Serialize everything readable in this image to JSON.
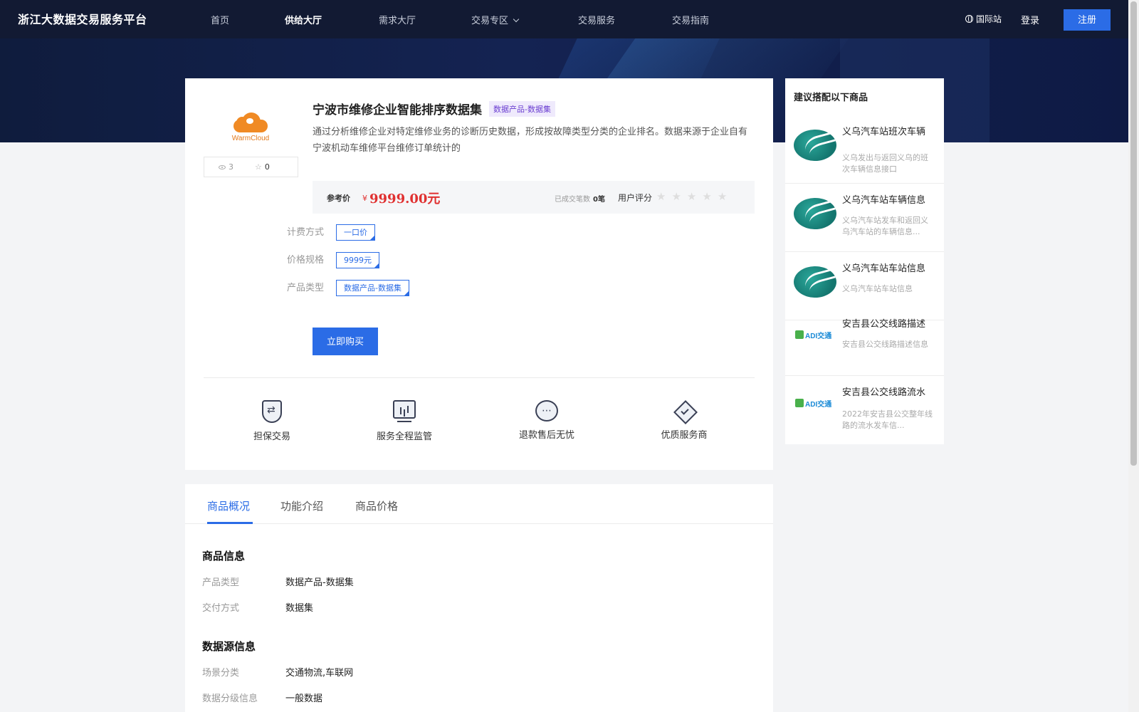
{
  "nav": {
    "logo": "浙江大数据交易服务平台",
    "items": [
      "首页",
      "供给大厅",
      "需求大厅",
      "交易专区",
      "交易服务",
      "交易指南"
    ],
    "intl": "国际站",
    "login": "登录",
    "register": "注册"
  },
  "product": {
    "brand": "WarmCloud",
    "views": "3",
    "favorites": "0",
    "title": "宁波市维修企业智能排序数据集",
    "tag": "数据产品-数据集",
    "description": "通过分析维修企业对特定维修业务的诊断历史数据，形成按故障类型分类的企业排名。数据来源于企业自有宁波机动车维修平台维修订单统计的",
    "price_label": "参考价",
    "price_symbol": "¥",
    "price": "9999.00元",
    "deals_label": "已成交笔数",
    "deals_value": "0笔",
    "rating_label": "用户评分",
    "stars": [
      "★",
      "★",
      "★",
      "★",
      "★"
    ],
    "specs": [
      {
        "label": "计费方式",
        "option": "一口价"
      },
      {
        "label": "价格规格",
        "option": "9999元"
      },
      {
        "label": "产品类型",
        "option": "数据产品-数据集"
      }
    ],
    "buy_label": "立即购买",
    "features": [
      "担保交易",
      "服务全程监管",
      "退款售后无忧",
      "优质服务商"
    ]
  },
  "recommend": {
    "title": "建议搭配以下商品",
    "items": [
      {
        "name": "义乌汽车站班次车辆",
        "desc": "义乌发出与返回义乌的班次车辆信息接口",
        "logo": "bus"
      },
      {
        "name": "义乌汽车站车辆信息",
        "desc": "义乌汽车站发车和返回义乌汽车站的车辆信息...",
        "logo": "bus"
      },
      {
        "name": "义乌汽车站车站信息",
        "desc": "义乌汽车站车站信息",
        "logo": "bus"
      },
      {
        "name": "安吉县公交线路描述",
        "desc": "安吉县公交线路描述信息",
        "logo": "adi"
      },
      {
        "name": "安吉县公交线路流水",
        "desc": "2022年安吉县公交整年线路的流水发车信...",
        "logo": "adi"
      }
    ],
    "adi_text": "ADI交通"
  },
  "tabs": [
    "商品概况",
    "功能介绍",
    "商品价格"
  ],
  "details": {
    "product_info_title": "商品信息",
    "product_type_label": "产品类型",
    "product_type_value": "数据产品-数据集",
    "delivery_label": "交付方式",
    "delivery_value": "数据集",
    "source_title": "数据源信息",
    "scene_label": "场景分类",
    "scene_value": "交通物流,车联网",
    "level_label": "数据分级信息",
    "level_value": "一般数据"
  },
  "colors": {
    "accent": "#2b6ce6",
    "price": "#e03030",
    "nav_bg": "#121a33"
  }
}
